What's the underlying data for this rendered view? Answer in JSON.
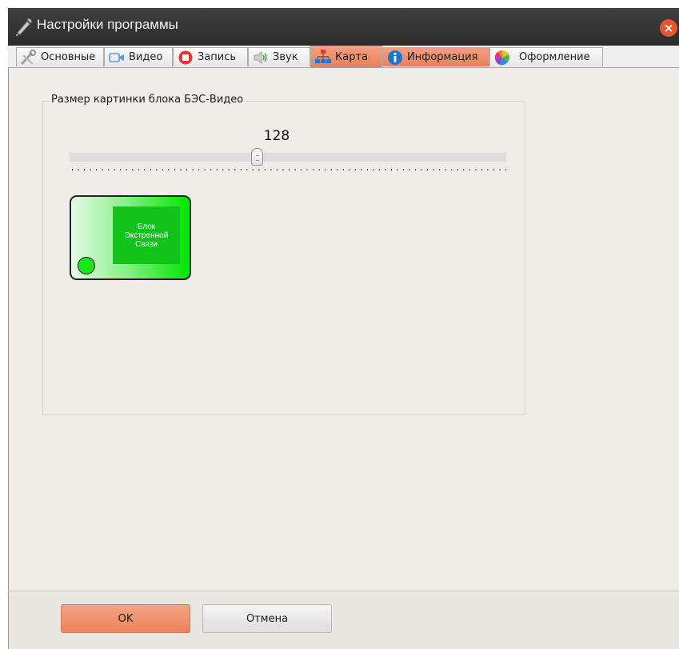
{
  "window": {
    "title": "Настройки программы",
    "title_icon": "wrench-pen-icon",
    "close_symbol": "×"
  },
  "tabs": [
    {
      "label": "Основные",
      "icon": "tools-icon",
      "state": "normal"
    },
    {
      "label": "Видео",
      "icon": "video-camera-icon",
      "state": "normal"
    },
    {
      "label": "Запись",
      "icon": "record-icon",
      "state": "normal"
    },
    {
      "label": "Звук",
      "icon": "speaker-icon",
      "state": "normal"
    },
    {
      "label": "Карта",
      "icon": "network-map-icon",
      "state": "active"
    },
    {
      "label": "Информация",
      "icon": "info-icon",
      "state": "highlighted"
    },
    {
      "label": "Оформление",
      "icon": "color-wheel-icon",
      "state": "normal"
    }
  ],
  "group": {
    "title": "Размер картинки блока БЭС-Видео"
  },
  "slider": {
    "value": 128,
    "value_label": "128",
    "min": 0,
    "max": 300,
    "tick_count": 73
  },
  "preview": {
    "label_lines": [
      "Блок",
      "Экстренной",
      "Связи"
    ]
  },
  "buttons": {
    "ok_label": "OK",
    "cancel_label": "Отмена"
  },
  "colors": {
    "accent": "#ec835d",
    "block_green": "#12c41a",
    "indicator_green": "#18e818",
    "titlebar": "#333333"
  }
}
